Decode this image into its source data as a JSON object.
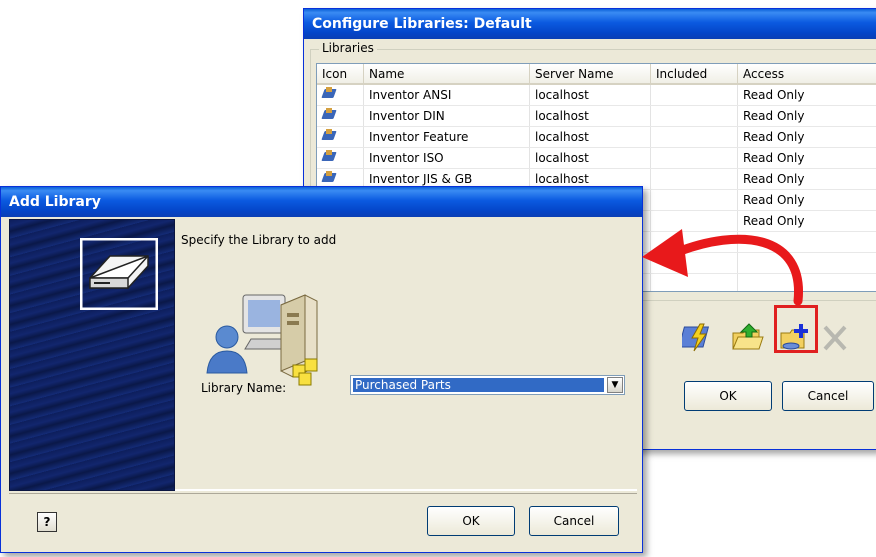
{
  "configure_window": {
    "title": "Configure Libraries: Default",
    "group_label": "Libraries",
    "columns": [
      "Icon",
      "Name",
      "Server Name",
      "Included",
      "Access"
    ],
    "rows": [
      {
        "name": "Inventor ANSI",
        "server": "localhost",
        "included": "",
        "access": "Read Only"
      },
      {
        "name": "Inventor DIN",
        "server": "localhost",
        "included": "",
        "access": "Read Only"
      },
      {
        "name": "Inventor Feature",
        "server": "localhost",
        "included": "",
        "access": "Read Only"
      },
      {
        "name": "Inventor ISO",
        "server": "localhost",
        "included": "",
        "access": "Read Only"
      },
      {
        "name": "Inventor JIS & GB",
        "server": "localhost",
        "included": "",
        "access": "Read Only"
      },
      {
        "name": "",
        "server": "",
        "included": "",
        "access": "Read Only"
      },
      {
        "name": "",
        "server": "",
        "included": "",
        "access": "Read Only"
      }
    ],
    "toolbar_icons": [
      "configure-icon",
      "open-library-icon",
      "add-library-icon",
      "remove-library-icon"
    ],
    "ok_label": "OK",
    "cancel_label": "Cancel"
  },
  "add_dialog": {
    "title": "Add Library",
    "prompt": "Specify the Library to add",
    "library_name_label": "Library Name:",
    "library_name_value": "Purchased Parts",
    "ok_label": "OK",
    "cancel_label": "Cancel",
    "help_icon": "help-icon"
  },
  "colors": {
    "title_bar": "#0a5fd8",
    "highlight_box": "#e02020",
    "arrow": "#e8191b",
    "selection": "#316ac5"
  }
}
